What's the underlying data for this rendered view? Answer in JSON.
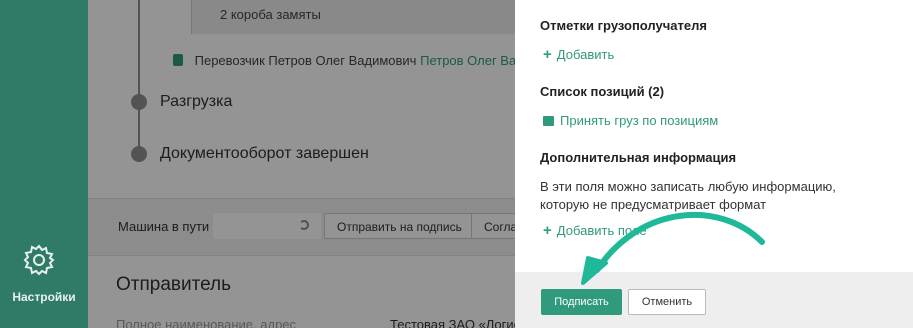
{
  "rail": {
    "settings_label": "Настройки",
    "settings_icon": "gear-icon"
  },
  "main": {
    "cargo_text": "2 короба замяты",
    "carrier_label": "Перевозчик",
    "carrier_name": "Петров Олег Вадимович",
    "carrier_link": "Петров Олег Ва",
    "timeline": [
      "Разгрузка",
      "Документооборот завершен"
    ],
    "status_label": "Машина в пути",
    "send_button": "Отправить на подпись",
    "agree_button": "Согла",
    "sender_title": "Отправитель",
    "sender_sub": "Полное наименование, адрес",
    "sender_value": "Тестовая ЗАО «Логис"
  },
  "panel": {
    "consignee_title": "Отметки грузополучателя",
    "add_label": "Добавить",
    "positions_title": "Список позиций (2)",
    "accept_label": "Принять груз по позициям",
    "extra_title": "Дополнительная информация",
    "extra_desc": "В эти поля можно записать любую информацию, которую не предусматривает формат",
    "add_field_label": "Добавить поле",
    "sign_button": "Подписать",
    "cancel_button": "Отменить"
  },
  "colors": {
    "accent": "#2f9a7c",
    "rail": "#2f7b67",
    "arrow": "#1fb99a"
  }
}
